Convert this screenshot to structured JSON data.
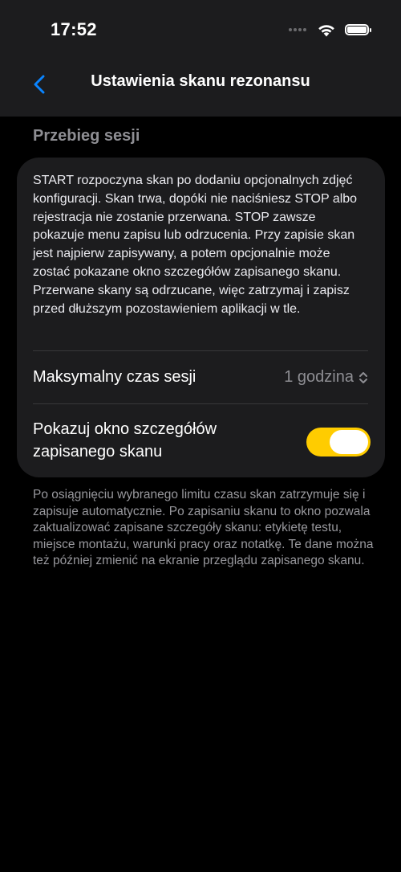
{
  "status_bar": {
    "time": "17:52",
    "signal_icon": "cellular-signal-icon",
    "wifi_icon": "wifi-icon",
    "battery_icon": "battery-icon",
    "battery_level": 1.0
  },
  "nav": {
    "back_icon": "chevron-left-icon",
    "title": "Ustawienia skanu rezonansu"
  },
  "section": {
    "header": "Przebieg sesji",
    "description": "START rozpoczyna skan po dodaniu opcjonalnych zdjęć konfiguracji. Skan trwa, dopóki nie naciśniesz STOP albo rejestracja nie zostanie przerwana. STOP zawsze pokazuje menu zapisu lub odrzucenia. Przy zapisie skan jest najpierw zapisywany, a potem opcjonalnie może zostać pokazane okno szczegółów zapisanego skanu. Przerwane skany są odrzucane, więc zatrzymaj i zapisz przed dłuższym pozostawieniem aplikacji w tle.",
    "max_duration": {
      "label": "Maksymalny czas sesji",
      "value": "1 godzina",
      "icon": "chevron-up-down-icon"
    },
    "details_toggle": {
      "label_line1": "Pokazuj okno szczegółów",
      "label_line2": "zapisanego skanu",
      "on": true
    },
    "footer": "Po osiągnięciu wybranego limitu czasu skan zatrzymuje się i zapisuje automatycznie. Po zapisaniu skanu to okno pozwala zaktualizować zapisane szczegóły skanu: etykietę testu, miejsce montażu, warunki pracy oraz notatkę. Te dane można też później zmienić na ekranie przeglądu zapisanego skanu."
  },
  "colors": {
    "accent": "#0a84ff",
    "toggle_on": "#ffcc00",
    "background": "#000000",
    "card": "#1c1c1e",
    "secondary_text": "#8e8e93"
  }
}
